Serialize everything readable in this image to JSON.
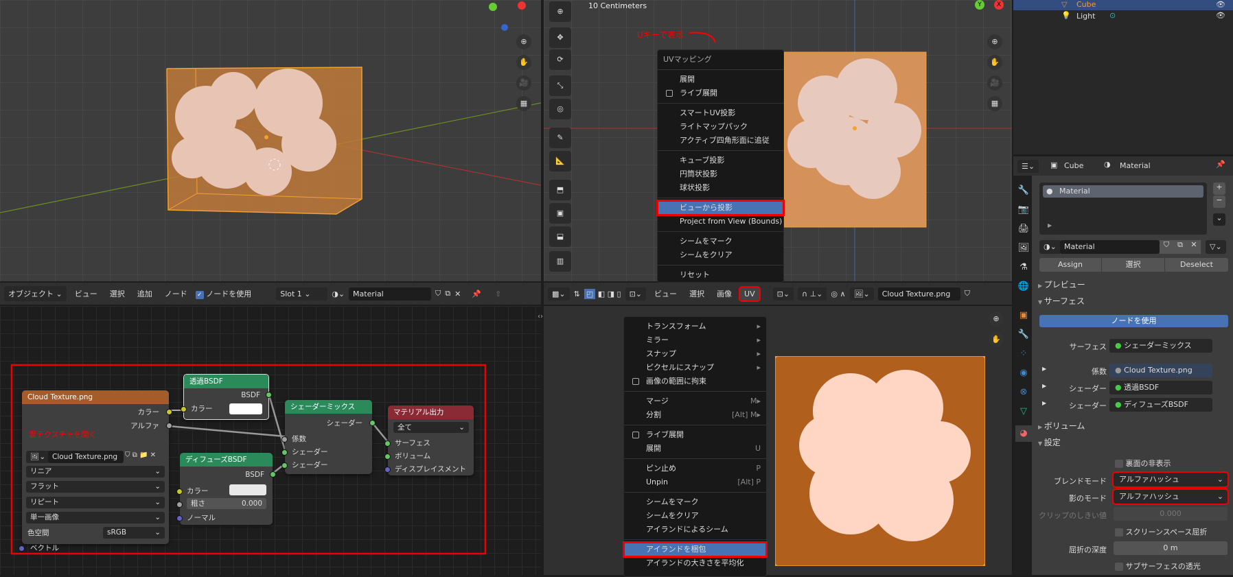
{
  "viewport3d": {
    "gizmo_x": "X"
  },
  "uv_view": {
    "scale_label": "10 Centimeters",
    "annotation": "Uキーで表示",
    "gizmo_y": "Y",
    "gizmo_x": "X"
  },
  "uv_mapping_menu": {
    "title": "UVマッピング",
    "items": [
      {
        "label": "展開"
      },
      {
        "label": "ライブ展開",
        "checkbox": true
      },
      {
        "label": "スマートUV投影"
      },
      {
        "label": "ライトマップパック"
      },
      {
        "label": "アクティブ四角形面に追従"
      },
      {
        "label": "キューブ投影"
      },
      {
        "label": "円筒状投影"
      },
      {
        "label": "球状投影"
      },
      {
        "label": "ビューから投影",
        "highlighted": true
      },
      {
        "label": "Project from View (Bounds)"
      },
      {
        "label": "シームをマーク"
      },
      {
        "label": "シームをクリア"
      },
      {
        "label": "リセット"
      }
    ]
  },
  "outliner": {
    "items": [
      {
        "label": "Cube",
        "selected": true
      },
      {
        "label": "Light"
      }
    ]
  },
  "node_header": {
    "mode": "オブジェクト",
    "menus": [
      "ビュー",
      "選択",
      "追加",
      "ノード"
    ],
    "use_nodes": "ノードを使用",
    "slot": "Slot 1",
    "material": "Material"
  },
  "uv_header": {
    "menus": [
      "ビュー",
      "選択",
      "画像",
      "UV"
    ],
    "image": "Cloud Texture.png"
  },
  "nodes": {
    "image": {
      "title": "Cloud Texture.png",
      "out_color": "カラー",
      "out_alpha": "アルファ",
      "annotation": "雲テクスチャを開く",
      "file": "Cloud Texture.png",
      "interp": "リニア",
      "proj": "フラット",
      "ext": "リピート",
      "source": "単一画像",
      "colorspace_label": "色空間",
      "colorspace": "sRGB",
      "vector": "ベクトル"
    },
    "transparent": {
      "title": "透過BSDF",
      "out": "BSDF",
      "color": "カラー"
    },
    "diffuse": {
      "title": "ディフューズBSDF",
      "out": "BSDF",
      "color": "カラー",
      "roughness": "粗さ",
      "roughness_value": "0.000",
      "normal": "ノーマル"
    },
    "mix": {
      "title": "シェーダーミックス",
      "out": "シェーダー",
      "fac": "係数",
      "shader1": "シェーダー",
      "shader2": "シェーダー"
    },
    "output": {
      "title": "マテリアル出力",
      "target": "全て",
      "surface": "サーフェス",
      "volume": "ボリューム",
      "displacement": "ディスプレイスメント"
    }
  },
  "uv_menu": {
    "items": [
      {
        "label": "トランスフォーム",
        "sub": true
      },
      {
        "label": "ミラー",
        "sub": true
      },
      {
        "label": "スナップ",
        "sub": true
      },
      {
        "label": "ピクセルにスナップ",
        "sub": true
      },
      {
        "label": "画像の範囲に拘束",
        "checkbox": true
      },
      {
        "label": "マージ",
        "shortcut": "M▸"
      },
      {
        "label": "分割",
        "shortcut": "[Alt] M▸"
      },
      {
        "label": "ライブ展開",
        "checkbox": true
      },
      {
        "label": "展開",
        "shortcut": "U"
      },
      {
        "label": "ピン止め",
        "shortcut": "P"
      },
      {
        "label": "Unpin",
        "shortcut": "[Alt] P"
      },
      {
        "label": "シームをマーク"
      },
      {
        "label": "シームをクリア"
      },
      {
        "label": "アイランドによるシーム"
      },
      {
        "label": "アイランドを梱包",
        "highlighted": true
      },
      {
        "label": "アイランドの大きさを平均化"
      }
    ]
  },
  "properties": {
    "breadcrumb_object": "Cube",
    "breadcrumb_material": "Material",
    "slot_item": "Material",
    "material_name": "Material",
    "assign": "Assign",
    "select": "選択",
    "deselect": "Deselect",
    "preview": "プレビュー",
    "surface_panel": "サーフェス",
    "use_nodes": "ノードを使用",
    "surface_label": "サーフェス",
    "surface_value": "シェーダーミックス",
    "fac_label": "係数",
    "fac_value": "Cloud Texture.png",
    "shader1_label": "シェーダー",
    "shader1_value": "透過BSDF",
    "shader2_label": "シェーダー",
    "shader2_value": "ディフューズBSDF",
    "volume": "ボリューム",
    "settings": "設定",
    "backface": "裏面の非表示",
    "blend_label": "ブレンドモード",
    "blend_value": "アルファハッシュ",
    "shadow_label": "影のモード",
    "shadow_value": "アルファハッシュ",
    "clip_label": "クリップのしきい値",
    "clip_value": "0.000",
    "ssr": "スクリーンスペース屈折",
    "refr_label": "屈折の深度",
    "refr_value": "0 m",
    "sss": "サブサーフェスの透光"
  },
  "colors": {
    "accent": "#4772b3",
    "highlight": "#ff0000",
    "orange": "#f5a030"
  }
}
